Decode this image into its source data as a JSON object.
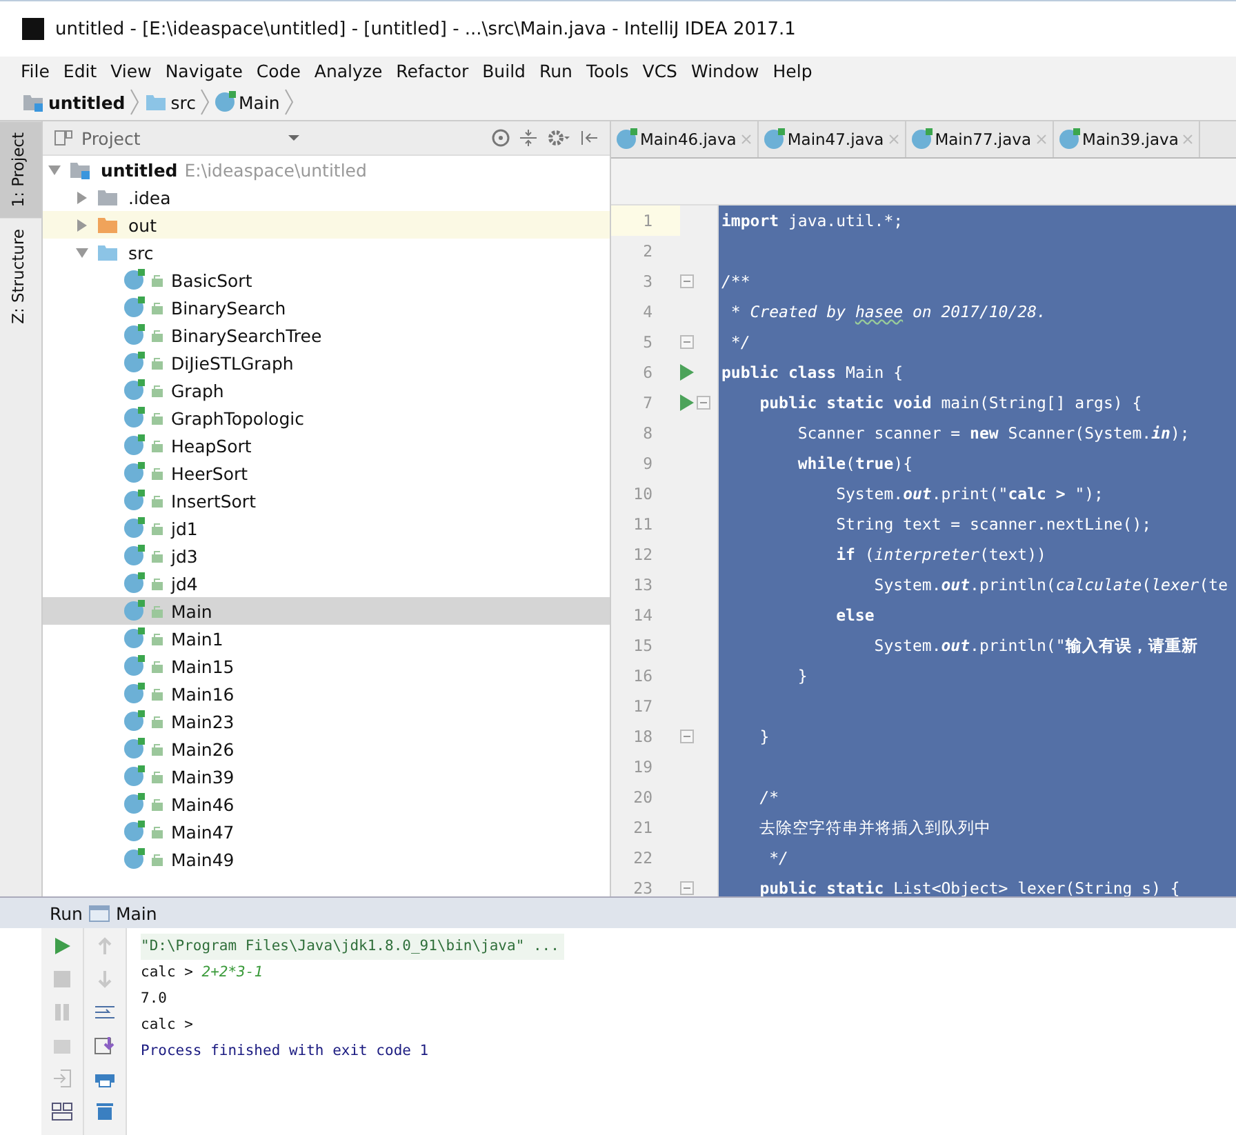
{
  "window": {
    "title": "untitled - [E:\\ideaspace\\untitled] - [untitled] - ...\\src\\Main.java - IntelliJ IDEA 2017.1"
  },
  "menu": [
    "File",
    "Edit",
    "View",
    "Navigate",
    "Code",
    "Analyze",
    "Refactor",
    "Build",
    "Run",
    "Tools",
    "VCS",
    "Window",
    "Help"
  ],
  "breadcrumb": [
    {
      "label": "untitled",
      "kind": "project"
    },
    {
      "label": "src",
      "kind": "folder"
    },
    {
      "label": "Main",
      "kind": "class"
    }
  ],
  "side_tabs": [
    {
      "label": "1: Project",
      "selected": true
    },
    {
      "label": "Z: Structure",
      "selected": false
    }
  ],
  "project_panel": {
    "title": "Project",
    "tree": [
      {
        "kind": "project",
        "label": "untitled",
        "path": "E:\\ideaspace\\untitled",
        "expanded": true,
        "selected": false,
        "children": [
          {
            "kind": "folder",
            "label": ".idea",
            "color": "#a9b0b8",
            "expanded": false,
            "highlighted": false,
            "selected": false
          },
          {
            "kind": "folder",
            "label": "out",
            "color": "#f0a35a",
            "expanded": false,
            "highlighted": true,
            "selected": false
          },
          {
            "kind": "folder",
            "label": "src",
            "color": "#8cc4e6",
            "expanded": true,
            "highlighted": false,
            "selected": false,
            "children": [
              {
                "kind": "class",
                "label": "BasicSort",
                "selected": false
              },
              {
                "kind": "class",
                "label": "BinarySearch",
                "selected": false
              },
              {
                "kind": "class",
                "label": "BinarySearchTree",
                "selected": false
              },
              {
                "kind": "class",
                "label": "DiJieSTLGraph",
                "selected": false
              },
              {
                "kind": "class",
                "label": "Graph",
                "selected": false
              },
              {
                "kind": "class",
                "label": "GraphTopologic",
                "selected": false
              },
              {
                "kind": "class",
                "label": "HeapSort",
                "selected": false
              },
              {
                "kind": "class",
                "label": "HeerSort",
                "selected": false
              },
              {
                "kind": "class",
                "label": "InsertSort",
                "selected": false
              },
              {
                "kind": "class",
                "label": "jd1",
                "selected": false
              },
              {
                "kind": "class",
                "label": "jd3",
                "selected": false
              },
              {
                "kind": "class",
                "label": "jd4",
                "selected": false
              },
              {
                "kind": "class",
                "label": "Main",
                "selected": true
              },
              {
                "kind": "class",
                "label": "Main1",
                "selected": false
              },
              {
                "kind": "class",
                "label": "Main15",
                "selected": false
              },
              {
                "kind": "class",
                "label": "Main16",
                "selected": false
              },
              {
                "kind": "class",
                "label": "Main23",
                "selected": false
              },
              {
                "kind": "class",
                "label": "Main26",
                "selected": false
              },
              {
                "kind": "class",
                "label": "Main39",
                "selected": false
              },
              {
                "kind": "class",
                "label": "Main46",
                "selected": false
              },
              {
                "kind": "class",
                "label": "Main47",
                "selected": false
              },
              {
                "kind": "class",
                "label": "Main49",
                "selected": false
              }
            ]
          }
        ]
      }
    ]
  },
  "editor_tabs": [
    {
      "label": "Main46.java",
      "selected": false
    },
    {
      "label": "Main47.java",
      "selected": false
    },
    {
      "label": "Main77.java",
      "selected": false
    },
    {
      "label": "Main39.java",
      "selected": false
    }
  ],
  "editor": {
    "selection": true,
    "lines": [
      {
        "n": "1",
        "current": true,
        "run_marker": false,
        "fold_marker": false,
        "segs": [
          {
            "t": "import",
            "kind": "keyword"
          },
          {
            "t": " java.util.*;",
            "kind": "plain"
          }
        ]
      },
      {
        "n": "2",
        "current": false,
        "run_marker": false,
        "fold_marker": false
      },
      {
        "n": "3",
        "current": false,
        "run_marker": false,
        "fold_marker": true,
        "segs": [
          {
            "t": "/**",
            "kind": "italic"
          }
        ]
      },
      {
        "n": "4",
        "current": false,
        "run_marker": false,
        "fold_marker": false,
        "segs": [
          {
            "t": " * Created by ",
            "kind": "italic"
          },
          {
            "t": "hasee",
            "kind": "typo"
          },
          {
            "t": " on 2017/10/28.",
            "kind": "italic"
          }
        ]
      },
      {
        "n": "5",
        "current": false,
        "run_marker": false,
        "fold_marker": true,
        "segs": [
          {
            "t": " */",
            "kind": "italic"
          }
        ]
      },
      {
        "n": "6",
        "current": false,
        "run_marker": true,
        "fold_marker": false,
        "segs": [
          {
            "t": "public class",
            "kind": "keyword"
          },
          {
            "t": " Main {",
            "kind": "plain"
          }
        ]
      },
      {
        "n": "7",
        "current": false,
        "run_marker": true,
        "fold_marker": true,
        "segs": [
          {
            "t": "    public static void",
            "kind": "keyword"
          },
          {
            "t": " main(String[] args) {",
            "kind": "plain"
          }
        ]
      },
      {
        "n": "8",
        "current": false,
        "run_marker": false,
        "fold_marker": false,
        "segs": [
          {
            "t": "        Scanner scanner = ",
            "kind": "plain"
          },
          {
            "t": "new",
            "kind": "keyword"
          },
          {
            "t": " Scanner(System.",
            "kind": "plain"
          },
          {
            "t": "in",
            "kind": "field"
          },
          {
            "t": ");",
            "kind": "plain"
          }
        ]
      },
      {
        "n": "9",
        "current": false,
        "run_marker": false,
        "fold_marker": false,
        "segs": [
          {
            "t": "        while",
            "kind": "keyword"
          },
          {
            "t": "(",
            "kind": "plain"
          },
          {
            "t": "true",
            "kind": "keyword"
          },
          {
            "t": "){",
            "kind": "plain"
          }
        ]
      },
      {
        "n": "10",
        "current": false,
        "run_marker": false,
        "fold_marker": false,
        "segs": [
          {
            "t": "            System.",
            "kind": "plain"
          },
          {
            "t": "out",
            "kind": "field"
          },
          {
            "t": ".print(\"",
            "kind": "plain"
          },
          {
            "t": "calc > ",
            "kind": "keyword"
          },
          {
            "t": "\");",
            "kind": "plain"
          }
        ]
      },
      {
        "n": "11",
        "current": false,
        "run_marker": false,
        "fold_marker": false,
        "segs": [
          {
            "t": "            String text = scanner.nextLine();",
            "kind": "plain"
          }
        ]
      },
      {
        "n": "12",
        "current": false,
        "run_marker": false,
        "fold_marker": false,
        "segs": [
          {
            "t": "            if",
            "kind": "keyword"
          },
          {
            "t": " (",
            "kind": "plain"
          },
          {
            "t": "interpreter",
            "kind": "italic"
          },
          {
            "t": "(text))",
            "kind": "plain"
          }
        ]
      },
      {
        "n": "13",
        "current": false,
        "run_marker": false,
        "fold_marker": false,
        "segs": [
          {
            "t": "                System.",
            "kind": "plain"
          },
          {
            "t": "out",
            "kind": "field"
          },
          {
            "t": ".println(",
            "kind": "plain"
          },
          {
            "t": "calculate",
            "kind": "italic"
          },
          {
            "t": "(",
            "kind": "plain"
          },
          {
            "t": "lexer",
            "kind": "italic"
          },
          {
            "t": "(te",
            "kind": "plain"
          }
        ]
      },
      {
        "n": "14",
        "current": false,
        "run_marker": false,
        "fold_marker": false,
        "segs": [
          {
            "t": "            else",
            "kind": "keyword"
          }
        ]
      },
      {
        "n": "15",
        "current": false,
        "run_marker": false,
        "fold_marker": false,
        "segs": [
          {
            "t": "                System.",
            "kind": "plain"
          },
          {
            "t": "out",
            "kind": "field"
          },
          {
            "t": ".println(\"",
            "kind": "plain"
          },
          {
            "t": "输入有误，请重新",
            "kind": "keyword"
          }
        ]
      },
      {
        "n": "16",
        "current": false,
        "run_marker": false,
        "fold_marker": false,
        "segs": [
          {
            "t": "        }",
            "kind": "plain"
          }
        ]
      },
      {
        "n": "17",
        "current": false,
        "run_marker": false,
        "fold_marker": false
      },
      {
        "n": "18",
        "current": false,
        "run_marker": false,
        "fold_marker": true,
        "segs": [
          {
            "t": "    }",
            "kind": "plain"
          }
        ]
      },
      {
        "n": "19",
        "current": false,
        "run_marker": false,
        "fold_marker": false
      },
      {
        "n": "20",
        "current": false,
        "run_marker": false,
        "fold_marker": false,
        "segs": [
          {
            "t": "    /*",
            "kind": "italic"
          }
        ]
      },
      {
        "n": "21",
        "current": false,
        "run_marker": false,
        "fold_marker": false,
        "segs": [
          {
            "t": "    去除空字符串并将插入到队列中",
            "kind": "plain"
          }
        ]
      },
      {
        "n": "22",
        "current": false,
        "run_marker": false,
        "fold_marker": false,
        "segs": [
          {
            "t": "     */",
            "kind": "italic"
          }
        ]
      },
      {
        "n": "23",
        "current": false,
        "run_marker": false,
        "fold_marker": true,
        "segs": [
          {
            "t": "    public static",
            "kind": "keyword"
          },
          {
            "t": " List<Object> lexer(String s) {",
            "kind": "plain"
          }
        ]
      }
    ]
  },
  "run_panel": {
    "label": "Run",
    "tab": "Main",
    "console": [
      {
        "kind": "command",
        "text": "\"D:\\Program Files\\Java\\jdk1.8.0_91\\bin\\java\" ..."
      },
      {
        "kind": "prompt",
        "text": "calc > ",
        "input": "2+2*3-1"
      },
      {
        "kind": "output",
        "text": "7.0"
      },
      {
        "kind": "prompt",
        "text": "calc > "
      },
      {
        "kind": "exit",
        "text": "Process finished with exit code 1"
      }
    ]
  }
}
